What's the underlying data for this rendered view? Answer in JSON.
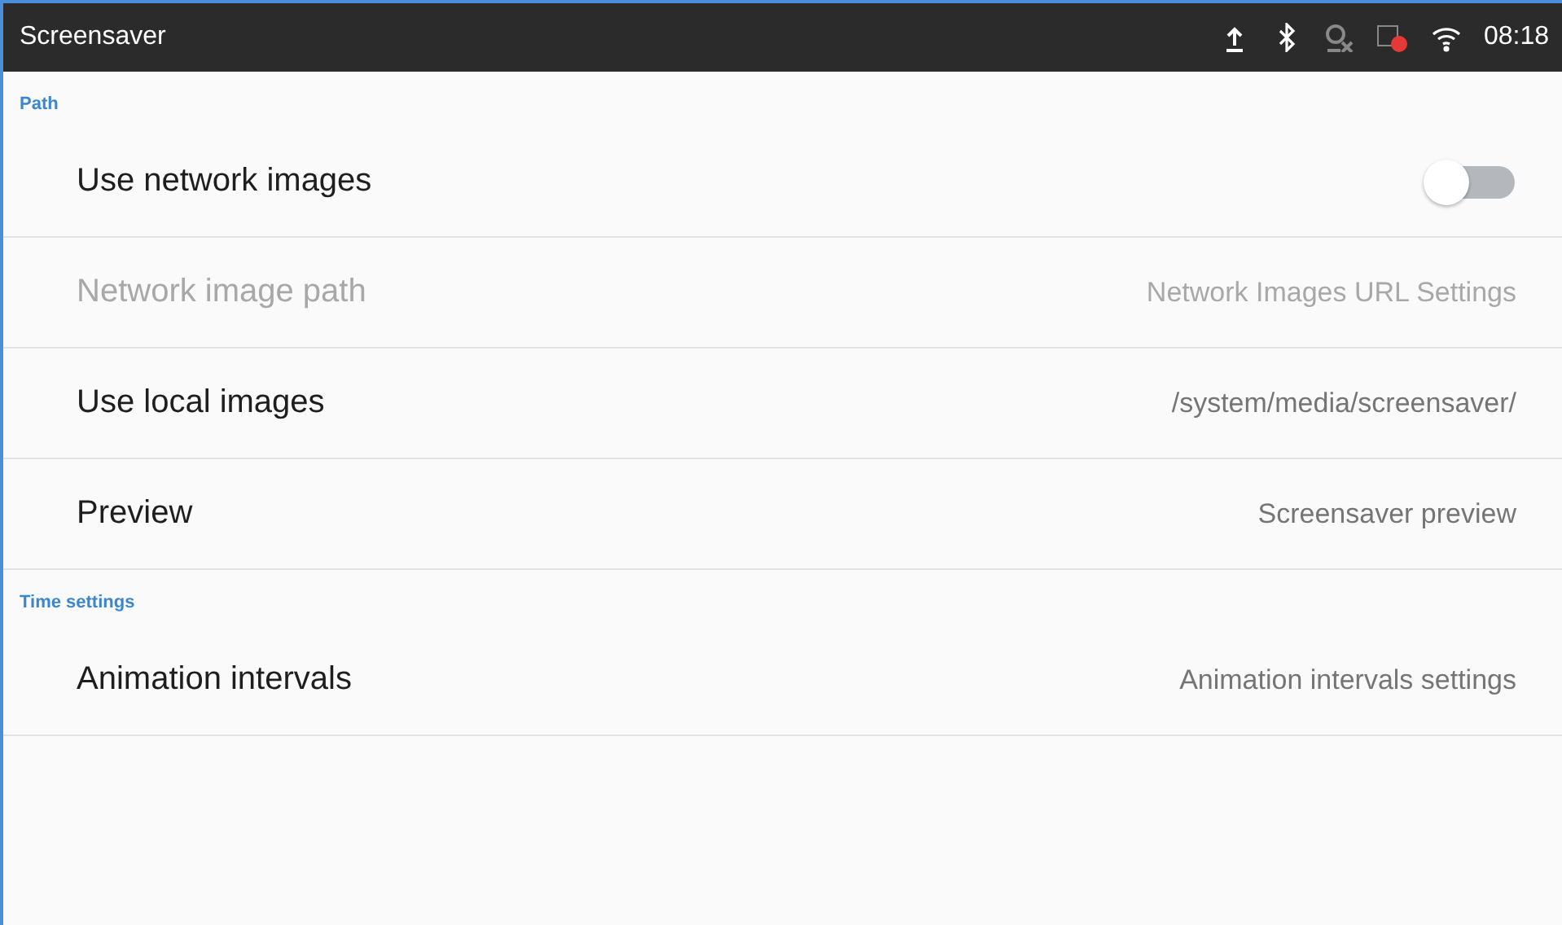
{
  "title_bar": {
    "title": "Screensaver",
    "time": "08:18"
  },
  "sections": [
    {
      "header": "Path",
      "items": [
        {
          "kind": "toggle",
          "label": "Use network images",
          "on": false,
          "disabled": false
        },
        {
          "kind": "value",
          "label": "Network image path",
          "value": "Network Images URL Settings",
          "disabled": true
        },
        {
          "kind": "value",
          "label": "Use local images",
          "value": "/system/media/screensaver/",
          "disabled": false
        },
        {
          "kind": "value",
          "label": "Preview",
          "value": "Screensaver preview",
          "disabled": false
        }
      ]
    },
    {
      "header": "Time settings",
      "items": [
        {
          "kind": "value",
          "label": "Animation intervals",
          "value": "Animation intervals settings",
          "disabled": false
        }
      ]
    }
  ]
}
